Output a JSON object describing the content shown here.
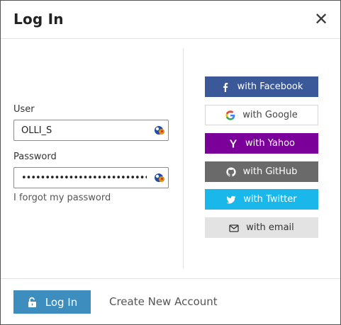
{
  "dialog": {
    "title": "Log In",
    "close_glyph": "✕"
  },
  "form": {
    "user_label": "User",
    "user_value": "OLLI_S",
    "password_label": "Password",
    "password_value": "••••••••••••••••••••••••••••••••",
    "forgot_link": "I forgot my password"
  },
  "social": {
    "facebook": "with Facebook",
    "google": "with Google",
    "yahoo": "with Yahoo",
    "github": "with GitHub",
    "twitter": "with Twitter",
    "email": "with email"
  },
  "footer": {
    "login_label": "Log In",
    "create_account": "Create New Account"
  },
  "colors": {
    "facebook": "#3b5998",
    "yahoo": "#7b0099",
    "github": "#6a6a6a",
    "twitter": "#1ab7ea",
    "email": "#e3e3e3",
    "login": "#3d8ebf"
  },
  "icons": {
    "close": "close-icon",
    "facebook": "facebook-icon",
    "google": "google-icon",
    "yahoo": "yahoo-icon",
    "github": "github-icon",
    "twitter": "twitter-icon",
    "email": "envelope-icon",
    "login": "unlock-icon",
    "field": "password-manager-icon"
  }
}
